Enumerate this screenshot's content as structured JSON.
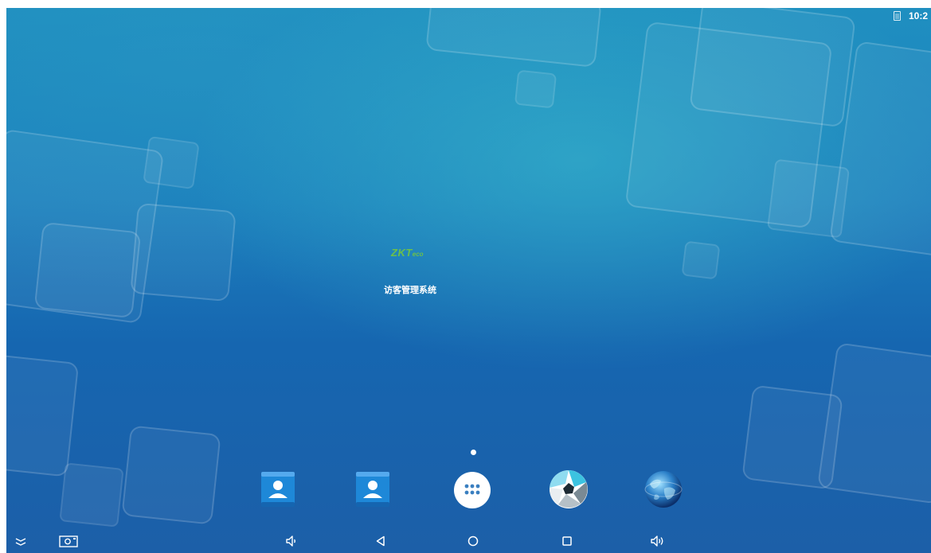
{
  "status_bar": {
    "time": "10:2",
    "sim_icon": "sim-card-icon"
  },
  "home": {
    "brand_logo": {
      "main": "ZKT",
      "sub": "eco"
    },
    "app_caption": "访客管理系统"
  },
  "dock": [
    {
      "name": "contacts-app-1",
      "icon": "contact-card-icon"
    },
    {
      "name": "contacts-app-2",
      "icon": "contact-card-icon"
    },
    {
      "name": "app-drawer",
      "icon": "grid-dots-icon"
    },
    {
      "name": "camera-app",
      "icon": "aperture-icon"
    },
    {
      "name": "browser-app",
      "icon": "globe-icon"
    }
  ],
  "nav_bar": {
    "buttons": [
      "expand-icon",
      "screenshot-icon",
      "volume-down-icon",
      "back-icon",
      "home-icon",
      "recents-icon",
      "volume-up-icon"
    ]
  },
  "colors": {
    "wallpaper_top": "#1f8fc0",
    "wallpaper_bottom": "#1c5fa8",
    "logo_green": "#6cc04a",
    "contacts_blue": "#1e88d8",
    "icon_white": "#ffffff"
  }
}
